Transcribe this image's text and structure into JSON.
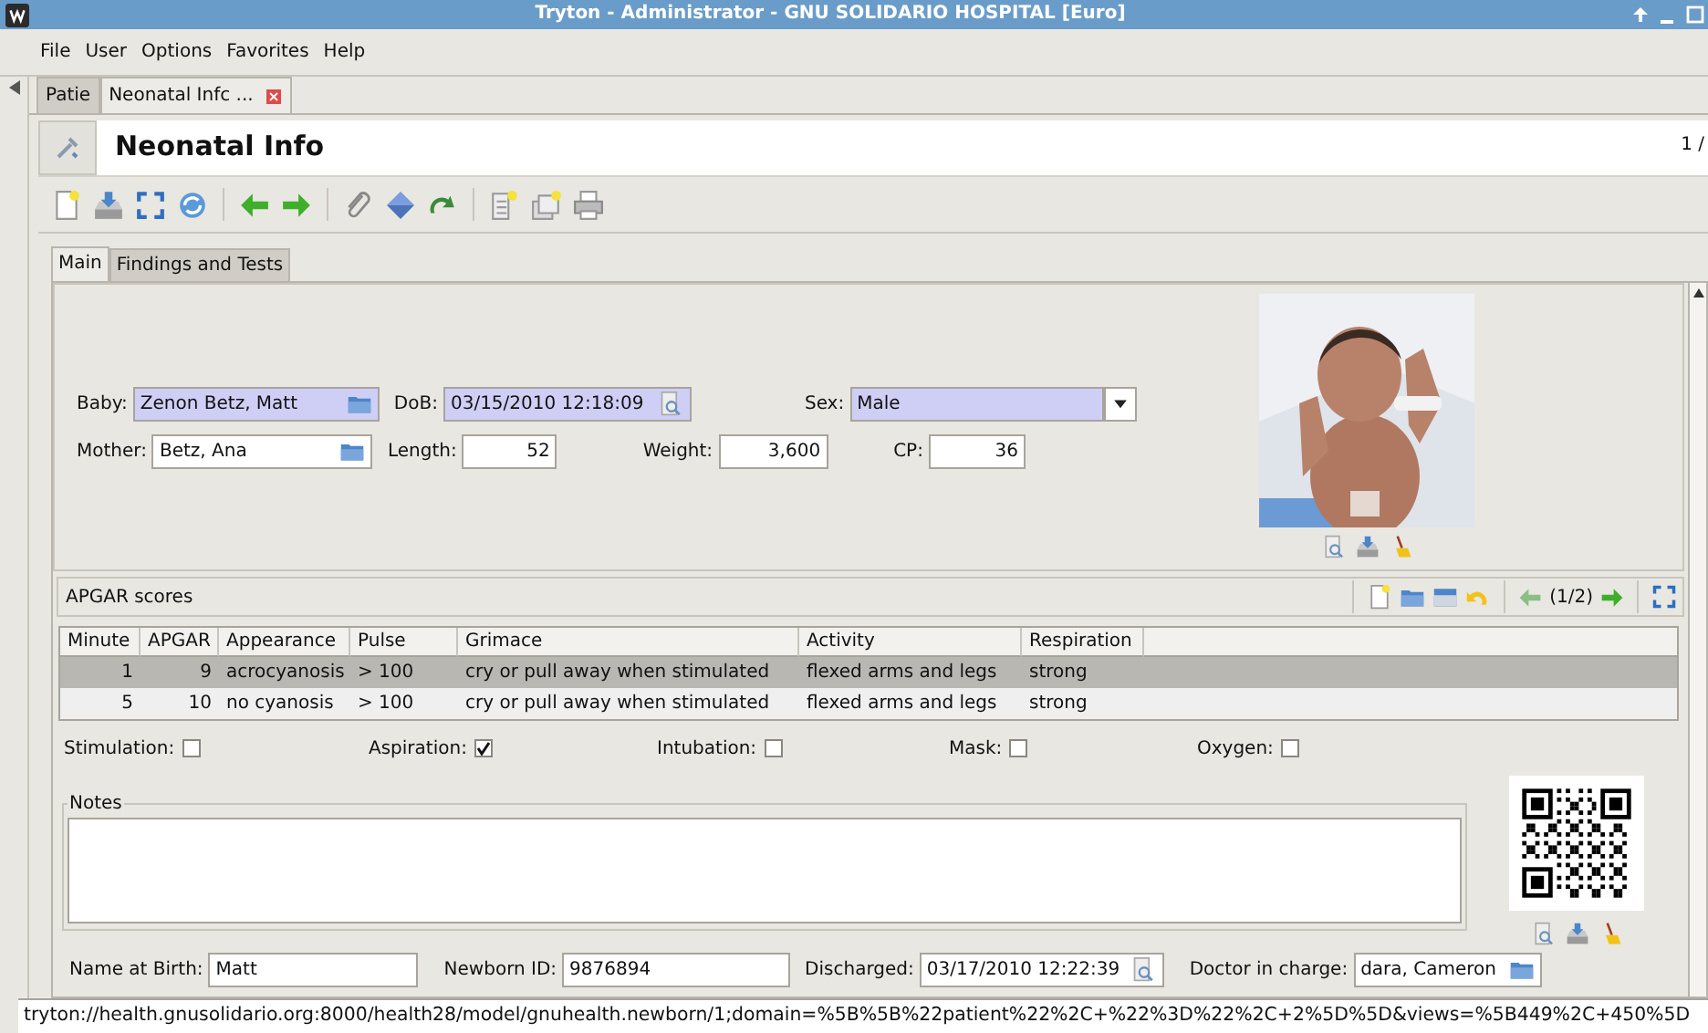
{
  "window": {
    "title": "Tryton - Administrator - GNU SOLIDARIO HOSPITAL [Euro]"
  },
  "menu": [
    "File",
    "User",
    "Options",
    "Favorites",
    "Help"
  ],
  "document_tabs": [
    {
      "label": "Patie",
      "selected": false
    },
    {
      "label": "Neonatal Infc ...",
      "selected": true
    }
  ],
  "header": {
    "title": "Neonatal Info",
    "record_counter": "1 /"
  },
  "form_tabs": [
    {
      "label": "Main",
      "selected": true
    },
    {
      "label": "Findings and Tests",
      "selected": false
    }
  ],
  "fields": [
    [
      {
        "label": "Baby:",
        "value": "Zenon Betz, Matt",
        "kind": "many2one",
        "required": true
      },
      {
        "label": "DoB:",
        "value": "03/15/2010 12:18:09",
        "kind": "datetime",
        "required": true
      },
      {
        "label": "Sex:",
        "value": "Male",
        "kind": "selection",
        "required": true
      }
    ],
    [
      {
        "label": "Mother:",
        "value": "Betz, Ana",
        "kind": "many2one",
        "required": false
      },
      {
        "label": "Length:",
        "value": "52",
        "kind": "number",
        "required": false
      },
      {
        "label": "Weight:",
        "value": "3,600",
        "kind": "number",
        "required": false
      },
      {
        "label": "CP:",
        "value": "36",
        "kind": "number",
        "required": false
      }
    ]
  ],
  "apgar": {
    "title": "APGAR scores",
    "counter": "(1/2)",
    "columns": [
      "Minute",
      "APGAR",
      "Appearance",
      "Pulse",
      "Grimace",
      "Activity",
      "Respiration"
    ],
    "rows": [
      {
        "cells": [
          "1",
          "9",
          "acrocyanosis",
          "> 100",
          "cry or pull away when stimulated",
          "flexed arms and legs",
          "strong"
        ],
        "selected": true
      },
      {
        "cells": [
          "5",
          "10",
          "no cyanosis",
          "> 100",
          "cry or pull away when stimulated",
          "flexed arms and legs",
          "strong"
        ],
        "selected": false
      }
    ]
  },
  "checkboxes": [
    {
      "label": "Stimulation:",
      "checked": false
    },
    {
      "label": "Aspiration:",
      "checked": true
    },
    {
      "label": "Intubation:",
      "checked": false
    },
    {
      "label": "Mask:",
      "checked": false
    },
    {
      "label": "Oxygen:",
      "checked": false
    }
  ],
  "notes": {
    "label": "Notes"
  },
  "bottom_fields": [
    {
      "label": "Name at Birth:",
      "value": "Matt",
      "kind": "char",
      "required": false
    },
    {
      "label": "Newborn ID:",
      "value": "9876894",
      "kind": "char",
      "required": false
    },
    {
      "label": "Discharged:",
      "value": "03/17/2010 12:22:39",
      "kind": "datetime",
      "required": false
    },
    {
      "label": "Doctor in charge:",
      "value": "dara, Cameron",
      "kind": "many2one",
      "required": false
    }
  ],
  "status_bar": "tryton://health.gnusolidario.org:8000/health28/model/gnuhealth.newborn/1;domain=%5B%5B%22patient%22%2C+%22%3D%22%2C+2%5D%5D&views=%5B449%2C+450%5D"
}
